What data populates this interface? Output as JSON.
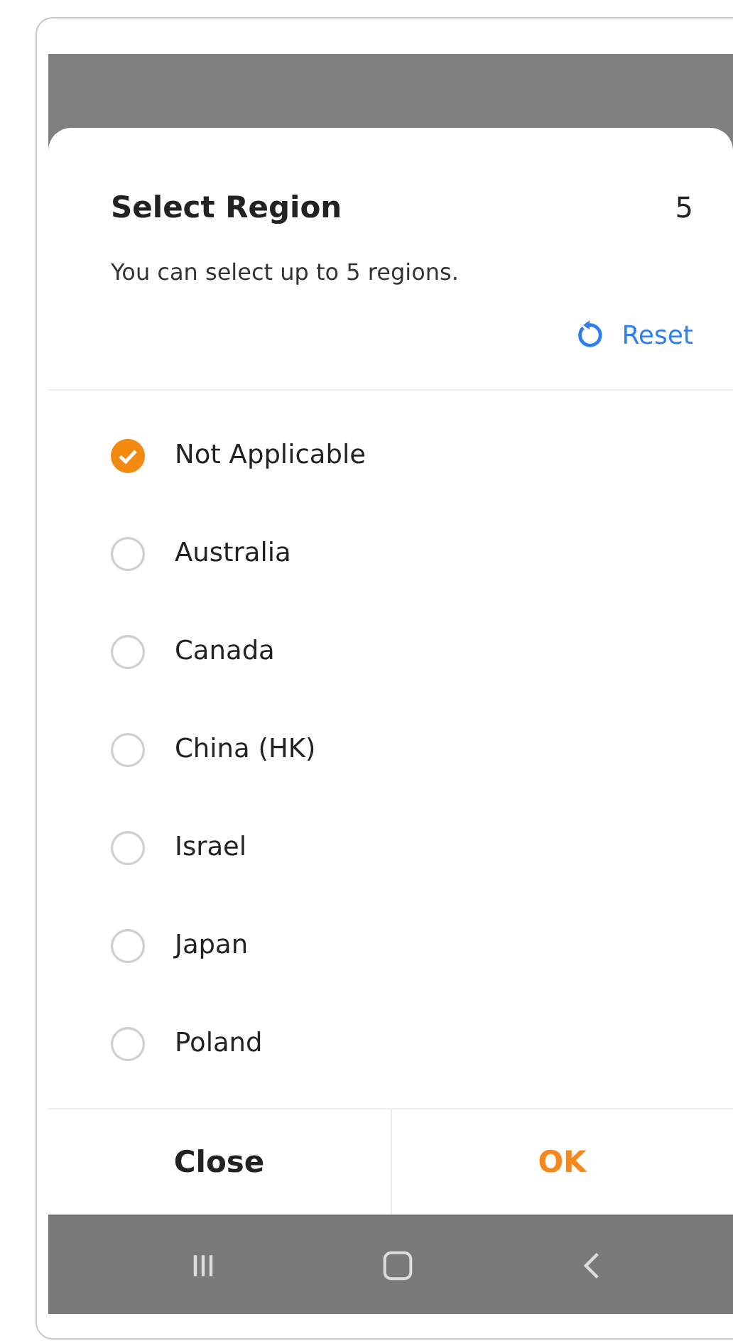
{
  "dialog": {
    "title": "Select Region",
    "count": "5",
    "subtitle": "You can select up to 5 regions.",
    "reset": "Reset"
  },
  "regions": [
    {
      "label": "Not Applicable",
      "selected": true
    },
    {
      "label": "Australia",
      "selected": false
    },
    {
      "label": "Canada",
      "selected": false
    },
    {
      "label": "China (HK)",
      "selected": false
    },
    {
      "label": "Israel",
      "selected": false
    },
    {
      "label": "Japan",
      "selected": false
    },
    {
      "label": "Poland",
      "selected": false
    }
  ],
  "buttons": [
    {
      "label": "Close",
      "kind": "cancel"
    },
    {
      "label": "OK",
      "kind": "confirm"
    }
  ]
}
